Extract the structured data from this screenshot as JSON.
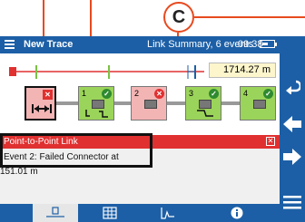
{
  "title_bar": {
    "title": "New Trace",
    "summary": "Link Summary, 6 events",
    "time": "09:38"
  },
  "trace": {
    "distance": "1714.27 m"
  },
  "events": [
    {
      "number": "",
      "status": "fail",
      "type": "launch"
    },
    {
      "number": "1",
      "status": "pass",
      "type": "connector"
    },
    {
      "number": "2",
      "status": "fail",
      "type": "connector"
    },
    {
      "number": "3",
      "status": "pass",
      "type": "splice"
    },
    {
      "number": "4",
      "status": "pass",
      "type": "connector"
    }
  ],
  "dialog": {
    "title": "Point-to-Point Link",
    "message": "Event 2: Failed Connector at 151.01 m"
  },
  "annotation": {
    "callout_label": "C"
  },
  "colors": {
    "header_blue": "#1c5fa6",
    "fail_red": "#e03030",
    "pass_green": "#7ac143",
    "annotation_orange": "#e84a1f"
  },
  "icons": {
    "right_panel": [
      "undo-arrow-icon",
      "left-arrow-icon",
      "right-arrow-icon",
      "menu-icon"
    ],
    "tabs": [
      "link-view-icon",
      "table-icon",
      "trace-graph-icon",
      "info-icon"
    ]
  }
}
